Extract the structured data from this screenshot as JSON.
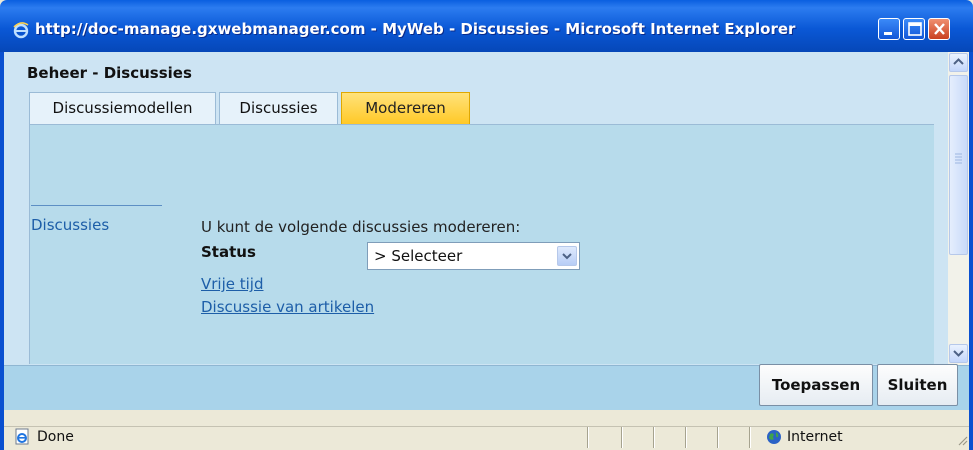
{
  "window": {
    "title": "http://doc-manage.gxwebmanager.com - MyWeb - Discussies - Microsoft Internet Explorer",
    "buttons": [
      "minimize-icon",
      "maximize-icon",
      "close-icon"
    ]
  },
  "page": {
    "title": "Beheer - Discussies"
  },
  "tabs": [
    {
      "label": "Discussiemodellen",
      "active": false
    },
    {
      "label": "Discussies",
      "active": false
    },
    {
      "label": "Modereren",
      "active": true
    }
  ],
  "sidebar": {
    "link": "Discussies"
  },
  "main": {
    "intro": "U kunt de volgende discussies modereren:",
    "status_label": "Status",
    "status_select": {
      "selected": "> Selecteer"
    },
    "links": [
      "Vrije tijd",
      "Discussie van artikelen"
    ]
  },
  "actions": {
    "apply": "Toepassen",
    "close": "Sluiten"
  },
  "statusbar": {
    "text": "Done",
    "zone": "Internet"
  },
  "colors": {
    "titlebar": "#0a58d6",
    "content_bg": "#cde4f3",
    "active_tab": "#ffc927",
    "link": "#1d5ea8"
  }
}
